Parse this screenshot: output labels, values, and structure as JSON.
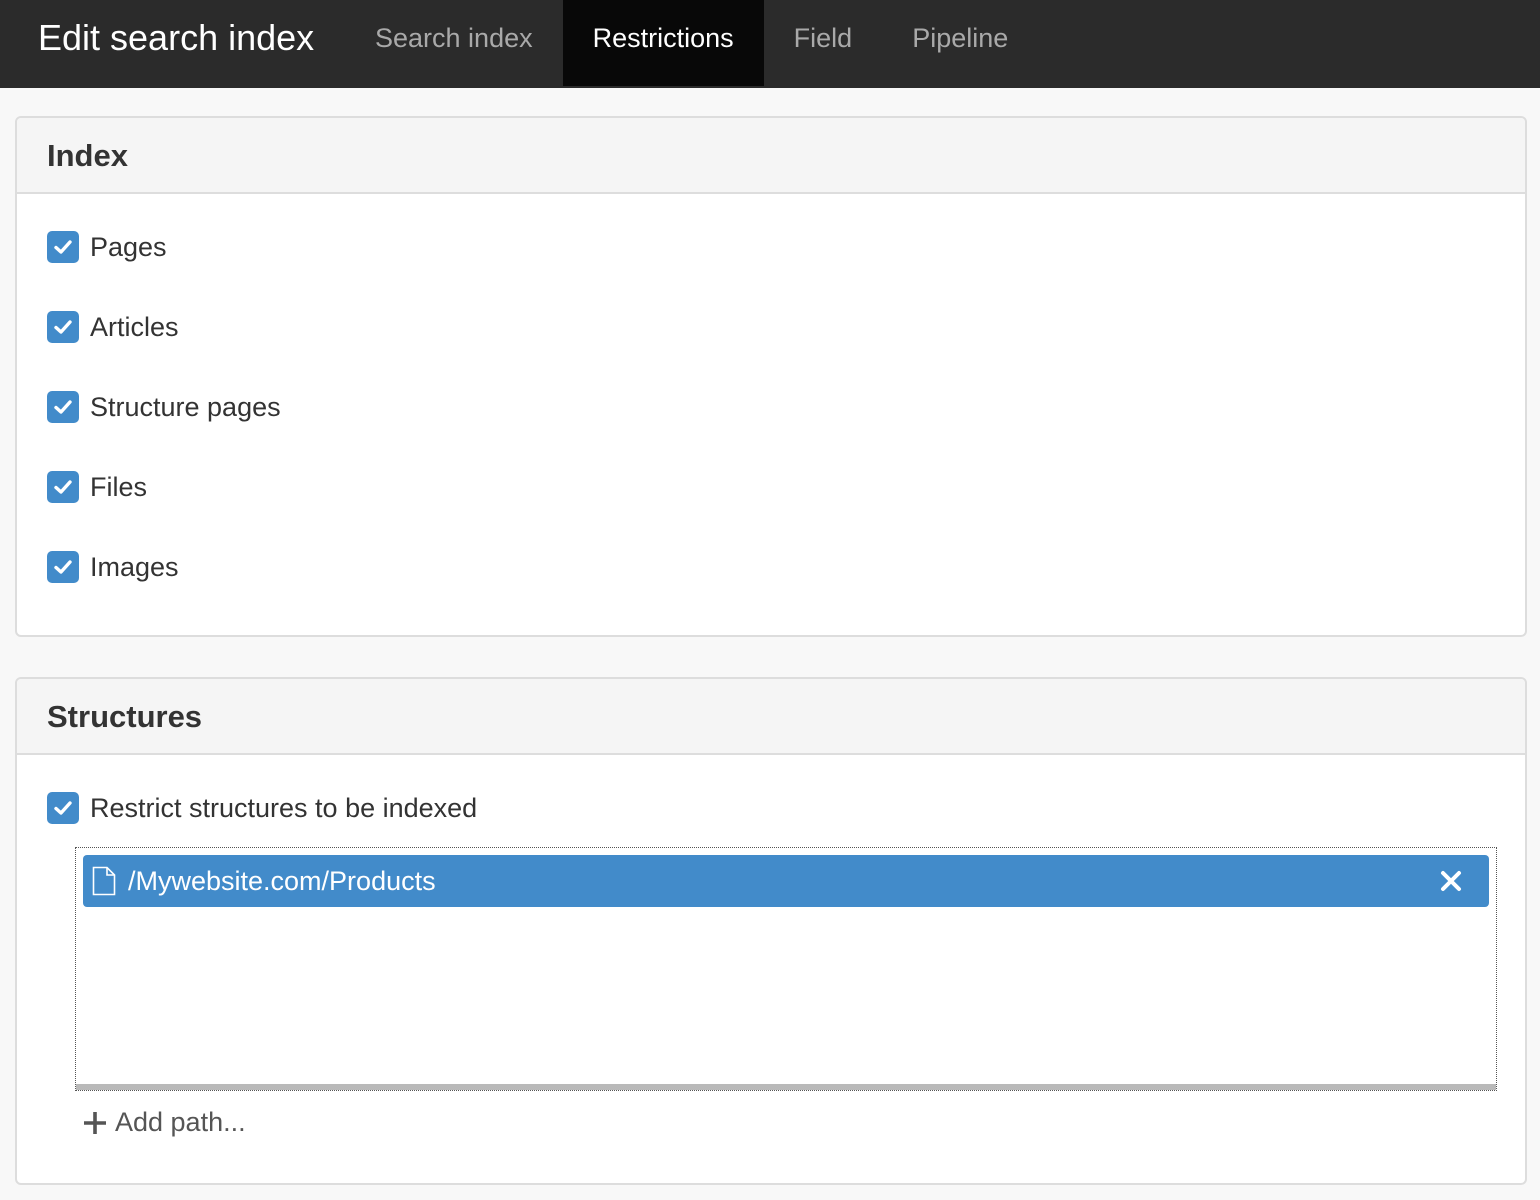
{
  "navbar": {
    "brand": "Edit search index",
    "tabs": [
      {
        "label": "Search index",
        "active": false
      },
      {
        "label": "Restrictions",
        "active": true
      },
      {
        "label": "Field",
        "active": false
      },
      {
        "label": "Pipeline",
        "active": false
      }
    ]
  },
  "index_panel": {
    "title": "Index",
    "options": [
      {
        "label": "Pages",
        "checked": true
      },
      {
        "label": "Articles",
        "checked": true
      },
      {
        "label": "Structure pages",
        "checked": true
      },
      {
        "label": "Files",
        "checked": true
      },
      {
        "label": "Images",
        "checked": true
      }
    ]
  },
  "structures_panel": {
    "title": "Structures",
    "restrict": {
      "label": "Restrict structures to be indexed",
      "checked": true
    },
    "paths": [
      {
        "label": "/Mywebsite.com/Products",
        "icon": "file-icon"
      }
    ],
    "add_path_label": "Add path..."
  },
  "colors": {
    "navbar_bg": "#2b2b2b",
    "active_tab_bg": "#080808",
    "accent": "#428bca",
    "panel_heading_bg": "#f5f5f5"
  }
}
